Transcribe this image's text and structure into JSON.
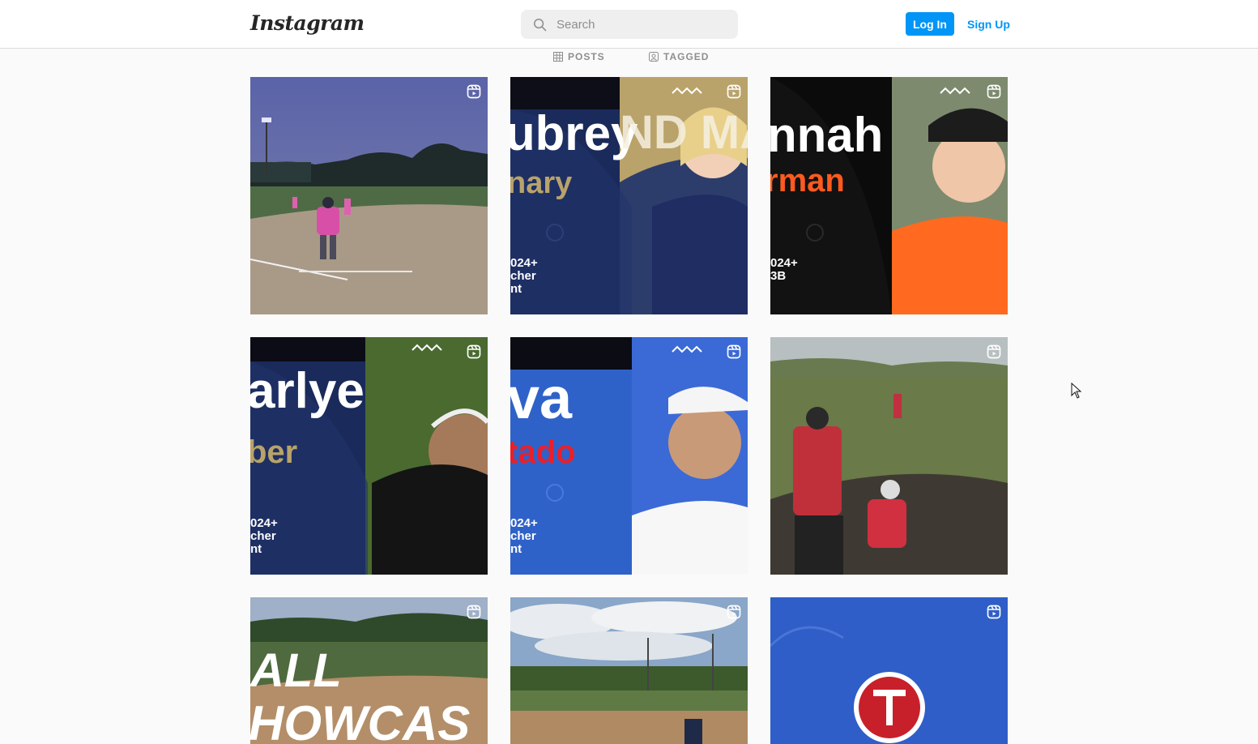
{
  "header": {
    "logo_text": "Instagram",
    "search_placeholder": "Search",
    "login_label": "Log In",
    "signup_label": "Sign Up"
  },
  "tabs": [
    {
      "label": "POSTS",
      "icon": "grid-icon"
    },
    {
      "label": "TAGGED",
      "icon": "tagged-icon"
    }
  ],
  "posts": [
    {
      "type": "reel",
      "scene": "night softball field"
    },
    {
      "type": "reel",
      "big": "ubrey",
      "sub": "nary",
      "small": "024+\ncher\nnt",
      "overlay": "ND MA"
    },
    {
      "type": "reel",
      "big": "nnah",
      "sub": "rman",
      "small": "024+\n3B"
    },
    {
      "type": "reel",
      "big": "arlye",
      "sub": "ber",
      "small": "024+\ncher\nnt"
    },
    {
      "type": "reel",
      "big": "va",
      "sub": "tado",
      "small": "024+\ncher\nnt"
    },
    {
      "type": "reel",
      "scene": "catcher and umpire"
    },
    {
      "type": "reel",
      "big": "ALL",
      "sub": "HOWCAS"
    },
    {
      "type": "reel",
      "scene": "softball game cloudy sky"
    },
    {
      "type": "reel",
      "scene": "logo on blue"
    }
  ],
  "colors": {
    "accent": "#0095f6",
    "navy": "#1a2a5a",
    "gold": "#b9a36a",
    "orange": "#ff5a1f",
    "red": "#e8202b",
    "blue": "#2f62c9"
  }
}
